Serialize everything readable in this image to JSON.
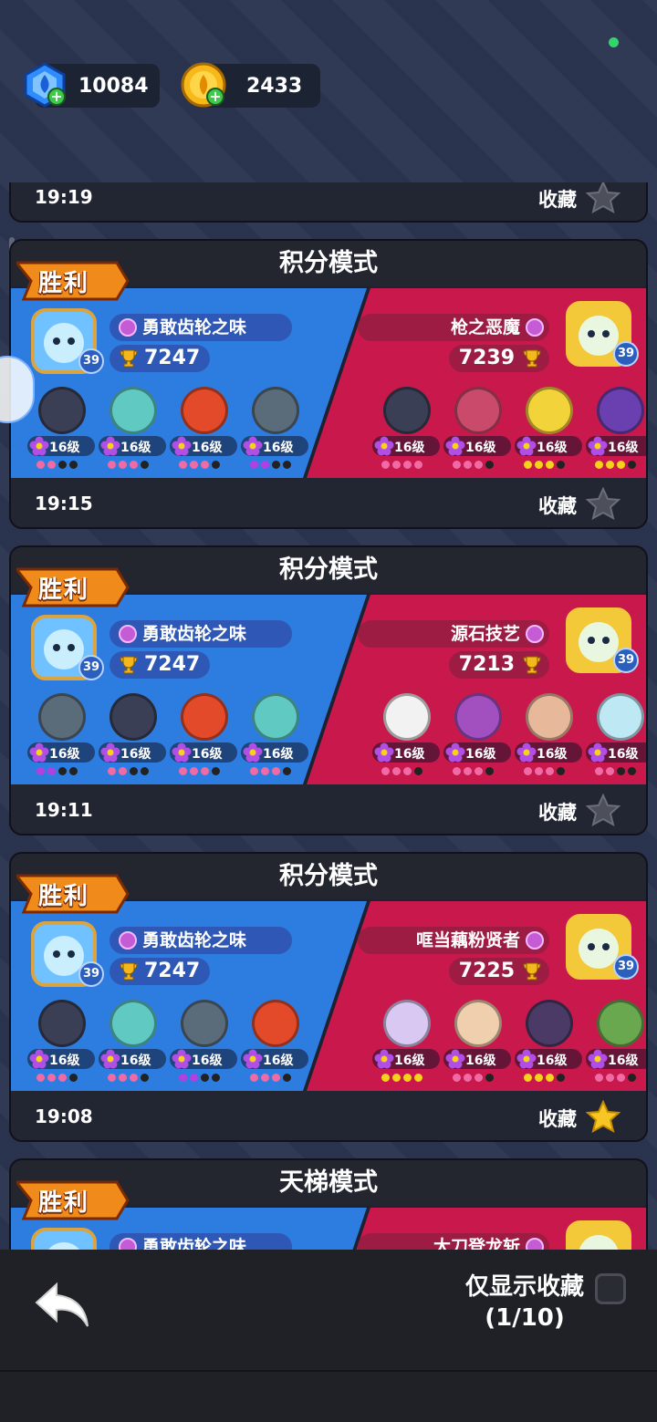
{
  "currencies": {
    "gems": {
      "value": "10084",
      "icon": "blue-gem-icon",
      "color": "#2f8cff"
    },
    "gold": {
      "value": "2433",
      "icon": "gold-coin-icon",
      "color": "#f7b81a"
    }
  },
  "partial_top_card": {
    "time": "19:19",
    "fav_label": "收藏",
    "starred": false
  },
  "matches": [
    {
      "mode": "积分模式",
      "result": "胜利",
      "time": "19:15",
      "fav_label": "收藏",
      "starred": false,
      "left": {
        "name": "勇敢齿轮之味",
        "score": "7247",
        "level": "39",
        "heroes": [
          {
            "level": "16级",
            "color": "#3b3f55",
            "dots": [
              1,
              1,
              0,
              0
            ],
            "dotColor": "#f06aa6"
          },
          {
            "level": "16级",
            "color": "#5fc9c2",
            "dots": [
              1,
              1,
              1,
              0
            ],
            "dotColor": "#f06aa6"
          },
          {
            "level": "16级",
            "color": "#e24a2a",
            "dots": [
              1,
              1,
              1,
              0
            ],
            "dotColor": "#f06aa6"
          },
          {
            "level": "16级",
            "color": "#5a6b7a",
            "dots": [
              1,
              1,
              0,
              0
            ],
            "dotColor": "#b040e0"
          }
        ]
      },
      "right": {
        "name": "枪之恶魔",
        "score": "7239",
        "level": "39",
        "heroes": [
          {
            "level": "16级",
            "color": "#3b3f55",
            "dots": [
              1,
              1,
              1,
              1
            ],
            "dotColor": "#f06aa6"
          },
          {
            "level": "16级",
            "color": "#c94a6a",
            "dots": [
              1,
              1,
              1,
              0
            ],
            "dotColor": "#f06aa6"
          },
          {
            "level": "16级",
            "color": "#f3d33a",
            "dots": [
              1,
              1,
              1,
              0
            ],
            "dotColor": "#f7d21a"
          },
          {
            "level": "16级",
            "color": "#6a3fb0",
            "dots": [
              1,
              1,
              1,
              0
            ],
            "dotColor": "#f7d21a"
          }
        ]
      }
    },
    {
      "mode": "积分模式",
      "result": "胜利",
      "time": "19:11",
      "fav_label": "收藏",
      "starred": false,
      "left": {
        "name": "勇敢齿轮之味",
        "score": "7247",
        "level": "39",
        "heroes": [
          {
            "level": "16级",
            "color": "#5a6b7a",
            "dots": [
              1,
              1,
              0,
              0
            ],
            "dotColor": "#b040e0"
          },
          {
            "level": "16级",
            "color": "#3b3f55",
            "dots": [
              1,
              1,
              0,
              0
            ],
            "dotColor": "#f06aa6"
          },
          {
            "level": "16级",
            "color": "#e24a2a",
            "dots": [
              1,
              1,
              1,
              0
            ],
            "dotColor": "#f06aa6"
          },
          {
            "level": "16级",
            "color": "#5fc9c2",
            "dots": [
              1,
              1,
              1,
              0
            ],
            "dotColor": "#f06aa6"
          }
        ]
      },
      "right": {
        "name": "源石技艺",
        "score": "7213",
        "level": "39",
        "heroes": [
          {
            "level": "16级",
            "color": "#f2f2f2",
            "dots": [
              1,
              1,
              1,
              0
            ],
            "dotColor": "#f06aa6"
          },
          {
            "level": "16级",
            "color": "#a24fc0",
            "dots": [
              1,
              1,
              1,
              0
            ],
            "dotColor": "#f06aa6"
          },
          {
            "level": "16级",
            "color": "#e8b89a",
            "dots": [
              1,
              1,
              1,
              0
            ],
            "dotColor": "#f06aa6"
          },
          {
            "level": "16级",
            "color": "#bfe8f5",
            "dots": [
              1,
              1,
              0,
              0
            ],
            "dotColor": "#f06aa6"
          }
        ]
      }
    },
    {
      "mode": "积分模式",
      "result": "胜利",
      "time": "19:08",
      "fav_label": "收藏",
      "starred": true,
      "left": {
        "name": "勇敢齿轮之味",
        "score": "7247",
        "level": "39",
        "heroes": [
          {
            "level": "16级",
            "color": "#3b3f55",
            "dots": [
              1,
              1,
              1,
              0
            ],
            "dotColor": "#f06aa6"
          },
          {
            "level": "16级",
            "color": "#5fc9c2",
            "dots": [
              1,
              1,
              1,
              0
            ],
            "dotColor": "#f06aa6"
          },
          {
            "level": "16级",
            "color": "#5a6b7a",
            "dots": [
              1,
              1,
              0,
              0
            ],
            "dotColor": "#b040e0"
          },
          {
            "level": "16级",
            "color": "#e24a2a",
            "dots": [
              1,
              1,
              1,
              0
            ],
            "dotColor": "#f06aa6"
          }
        ]
      },
      "right": {
        "name": "哐当藕粉贤者",
        "score": "7225",
        "level": "39",
        "heroes": [
          {
            "level": "16级",
            "color": "#d8c8f2",
            "dots": [
              1,
              1,
              1,
              1
            ],
            "dotColor": "#f7d21a"
          },
          {
            "level": "16级",
            "color": "#f0cfae",
            "dots": [
              1,
              1,
              1,
              0
            ],
            "dotColor": "#f06aa6"
          },
          {
            "level": "16级",
            "color": "#4b3a66",
            "dots": [
              1,
              1,
              1,
              0
            ],
            "dotColor": "#f7d21a"
          },
          {
            "level": "16级",
            "color": "#6aa84f",
            "dots": [
              1,
              1,
              1,
              0
            ],
            "dotColor": "#f06aa6"
          }
        ]
      }
    },
    {
      "mode": "天梯模式",
      "result": "胜利",
      "time": "",
      "fav_label": "",
      "starred": false,
      "left": {
        "name": "勇敢齿轮之味",
        "score": "",
        "level": "",
        "heroes": []
      },
      "right": {
        "name": "大刀登龙斩",
        "score": "",
        "level": "",
        "heroes": []
      }
    }
  ],
  "footer": {
    "only_fav_label": "仅显示收藏",
    "fav_count": "(1/10)",
    "only_fav_checked": false
  },
  "colors": {
    "left_team": "#2d7de0",
    "right_team": "#c8184c",
    "star_active": "#f6c625",
    "star_inactive": "#4d505a"
  }
}
